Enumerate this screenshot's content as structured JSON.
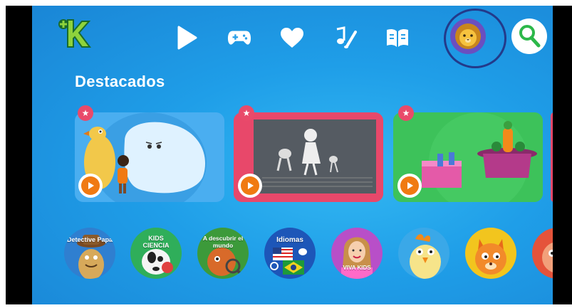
{
  "nav": {
    "icons": [
      "play-icon",
      "gamepad-icon",
      "heart-icon",
      "music-brush-icon",
      "book-icon"
    ],
    "avatar_icon": "lion-icon",
    "search_icon": "search-icon"
  },
  "featured": {
    "title": "Destacados",
    "cards": [
      {
        "name": "featured-card-1",
        "bg": "#3aa0e8"
      },
      {
        "name": "featured-card-2",
        "bg": "#e8486a"
      },
      {
        "name": "featured-card-3",
        "bg": "#3dc25a"
      }
    ]
  },
  "channels": [
    {
      "label": "Detective Papa",
      "bg": "#2f7fd0"
    },
    {
      "label": "KIDS CIENCIA",
      "bg": "#2fae5a"
    },
    {
      "label": "A descubrir el mundo",
      "bg": "#3c9a3a"
    },
    {
      "label": "Idiomas",
      "bg": "#1d56b8"
    },
    {
      "label": "VIVA KIDS",
      "bg": "#b84fc8"
    },
    {
      "label": "",
      "bg": "#3aa8e8"
    },
    {
      "label": "",
      "bg": "#f2c51e"
    },
    {
      "label": "",
      "bg": "#e5533a"
    }
  ],
  "colors": {
    "brand_green": "#8ed33c",
    "accent_orange": "#f07a12",
    "badge_pink": "#e94a6a"
  }
}
